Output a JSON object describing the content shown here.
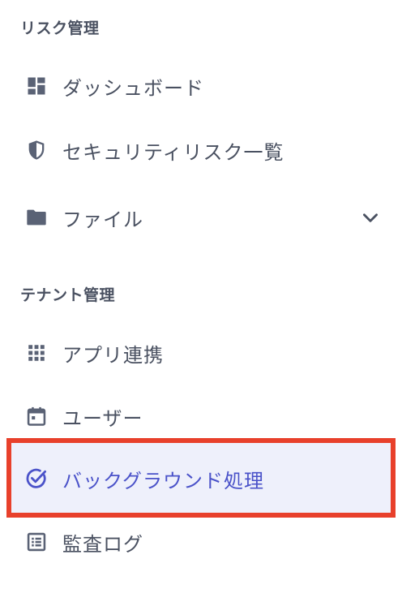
{
  "sections": {
    "risk": {
      "title": "リスク管理",
      "items": [
        {
          "label": "ダッシュボード",
          "icon": "dashboard-icon"
        },
        {
          "label": "セキュリティリスク一覧",
          "icon": "shield-icon"
        },
        {
          "label": "ファイル",
          "icon": "folder-icon",
          "expandable": true
        }
      ]
    },
    "tenant": {
      "title": "テナント管理",
      "items": [
        {
          "label": "アプリ連携",
          "icon": "grid-icon"
        },
        {
          "label": "ユーザー",
          "icon": "calendar-icon"
        },
        {
          "label": "バックグラウンド処理",
          "icon": "check-circle-icon",
          "active": true
        },
        {
          "label": "監査ログ",
          "icon": "list-icon"
        }
      ]
    }
  },
  "colors": {
    "text": "#4a5161",
    "active_text": "#4a52c9",
    "active_bg": "#eef0fb",
    "highlight": "#e8402b"
  }
}
